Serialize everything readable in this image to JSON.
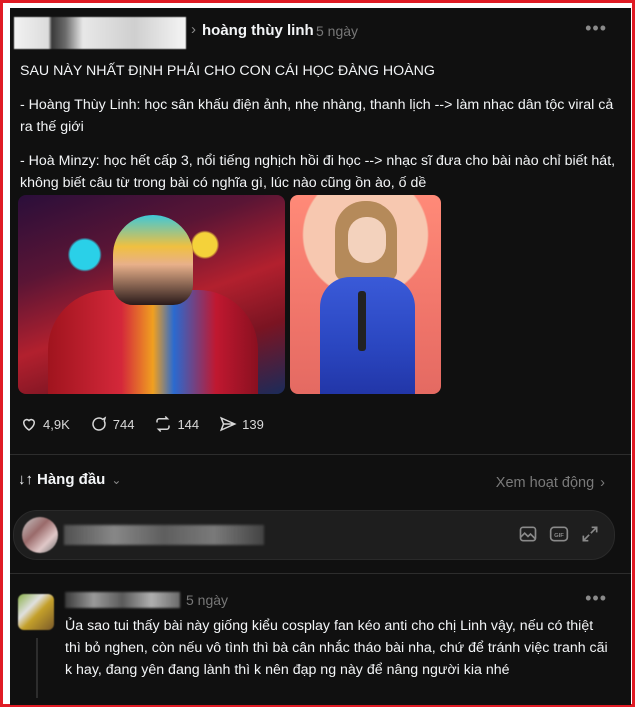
{
  "post": {
    "author": "hoàng thùy linh",
    "time": "5 ngày",
    "paragraphs": [
      "SAU NÀY NHẤT ĐỊNH PHẢI CHO CON CÁI HỌC ĐÀNG HOÀNG",
      "- Hoàng Thùy Linh: học sân khấu điện ảnh, nhẹ nhàng, thanh lịch --> làm nhạc dân tộc viral cả ra thế giới",
      "- Hoà Minzy: học hết cấp 3, nổi tiếng nghịch hồi đi học --> nhạc sĩ đưa cho bài nào chỉ biết hát, không biết câu từ trong bài có nghĩa gì, lúc nào cũng ồn ào, ố dề"
    ],
    "stats": {
      "likes": "4,9K",
      "comments": "744",
      "reposts": "144",
      "shares": "139"
    }
  },
  "sort": {
    "label": "Hàng đầu",
    "activity_link": "Xem hoạt động"
  },
  "comment": {
    "time": "5 ngày",
    "text": "Ủa sao tui thấy bài này giống kiểu cosplay fan kéo anti cho chị Linh vậy, nếu có thiệt thì bỏ nghen, còn nếu vô tình thì bà cân nhắc tháo bài nha, chứ để tránh việc tranh cãi k hay, đang yên đang lành thì k nên đạp ng này để nâng người kia nhé"
  },
  "colors": {
    "background": "#101010",
    "text": "#f3f5f7",
    "muted": "#777777",
    "frame": "#e01b24"
  },
  "icons": [
    "chevron-right-icon",
    "more-icon",
    "heart-icon",
    "comment-icon",
    "repost-icon",
    "share-icon",
    "sort-icon",
    "chevron-down-icon",
    "image-icon",
    "gif-icon",
    "expand-icon"
  ]
}
